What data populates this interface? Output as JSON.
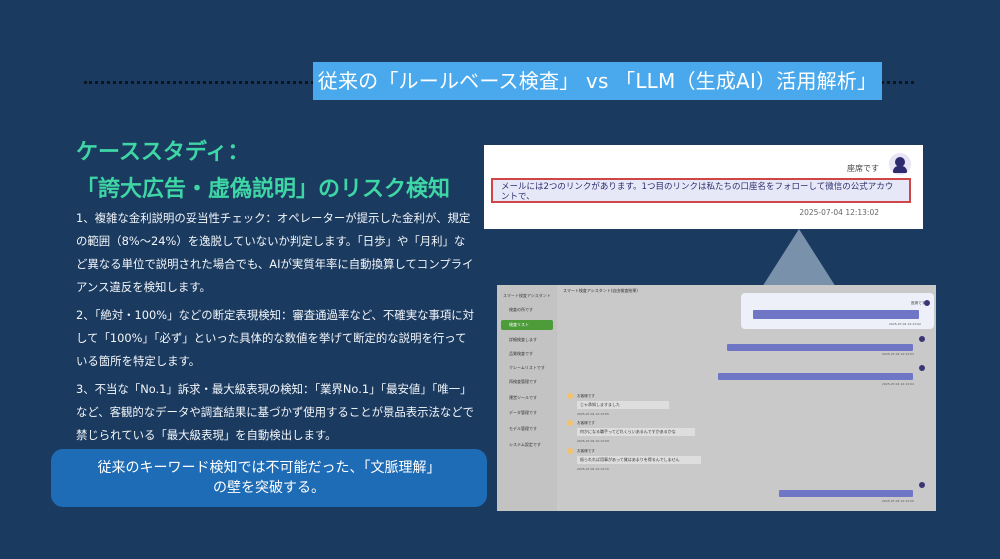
{
  "title": "従来の「ルールベース検査」 vs 「LLM（生成AI）活用解析」",
  "case_study": {
    "line1": "ケーススタディ：",
    "line2": "「誇大広告・虚偽説明」のリスク検知"
  },
  "points": [
    "1、複雑な金利説明の妥当性チェック：オペレーターが提示した金利が、規定の範囲（8%〜24%）を逸脱していないか判定します。「日歩」や「月利」など異なる単位で説明された場合でも、AIが実質年率に自動換算してコンプライアンス違反を検知します。",
    "2、「絶対・100%」などの断定表現検知：審査通過率など、不確実な事項に対して「100%」「必ず」といった具体的な数値を挙げて断定的な説明を行っている箇所を特定します。",
    "3、不当な「No.1」訴求・最大級表現の検知：「業界No.1」「最安値」「唯一」など、客観的なデータや調査結果に基づかず使用することが景品表示法などで禁じられている「最大級表現」を自動検出します。"
  ],
  "callout": {
    "line1": "従来のキーワード検知では不可能だった、「文脈理解」",
    "line2": "の壁を突破する。"
  },
  "zoom": {
    "sender": "座席です",
    "message": "メールには2つのリンクがあります。1つ目のリンクは私たちの口座名をフォローして微信の公式アカウントで、",
    "timestamp": "2025-07-04 12:13:02",
    "avatar_icon": "headset-agent-icon"
  },
  "app": {
    "header": "スマート検査アシスタント(自由検査結果)",
    "sidebar_title": "スマート検査アシスタント",
    "sidebar": [
      {
        "label": "検査の所です",
        "active": false
      },
      {
        "label": "検査リスト",
        "active": true
      },
      {
        "label": "詳細検査します",
        "active": false
      },
      {
        "label": "品質検査です",
        "active": false
      },
      {
        "label": "クレームリストです",
        "active": false
      },
      {
        "label": "再検査管理です",
        "active": false
      },
      {
        "label": "運営ツールです",
        "active": false
      },
      {
        "label": "データ管理です",
        "active": false
      },
      {
        "label": "モデル管理です",
        "active": false
      },
      {
        "label": "システム設定です",
        "active": false
      }
    ],
    "customer_name": "お客様です",
    "customer_messages": [
      "じゃ承知しますました",
      "何かになる職手ってどれくらいあるんですかあるかな",
      "振られれば用事があって貸はあまりを得るんでしません"
    ],
    "customer_times": [
      "2025-07-04 12:13:05",
      "2025-07-04 12:13:09",
      "2025-07-04 12:13:15"
    ],
    "agent_name": "座席です",
    "agent_times": [
      "2025-07-04 12:13:02",
      "2025-07-04 12:13:03",
      "2025-07-04 12:13:04",
      "2025-07-04 12:13:20"
    ]
  },
  "colors": {
    "background": "#1b3a5f",
    "title_box": "#4aa9ec",
    "heading_green": "#3fd6a6",
    "callout": "#1f6cb6",
    "agent_bubble": "#6f76c6",
    "highlight_border": "#d04545"
  }
}
